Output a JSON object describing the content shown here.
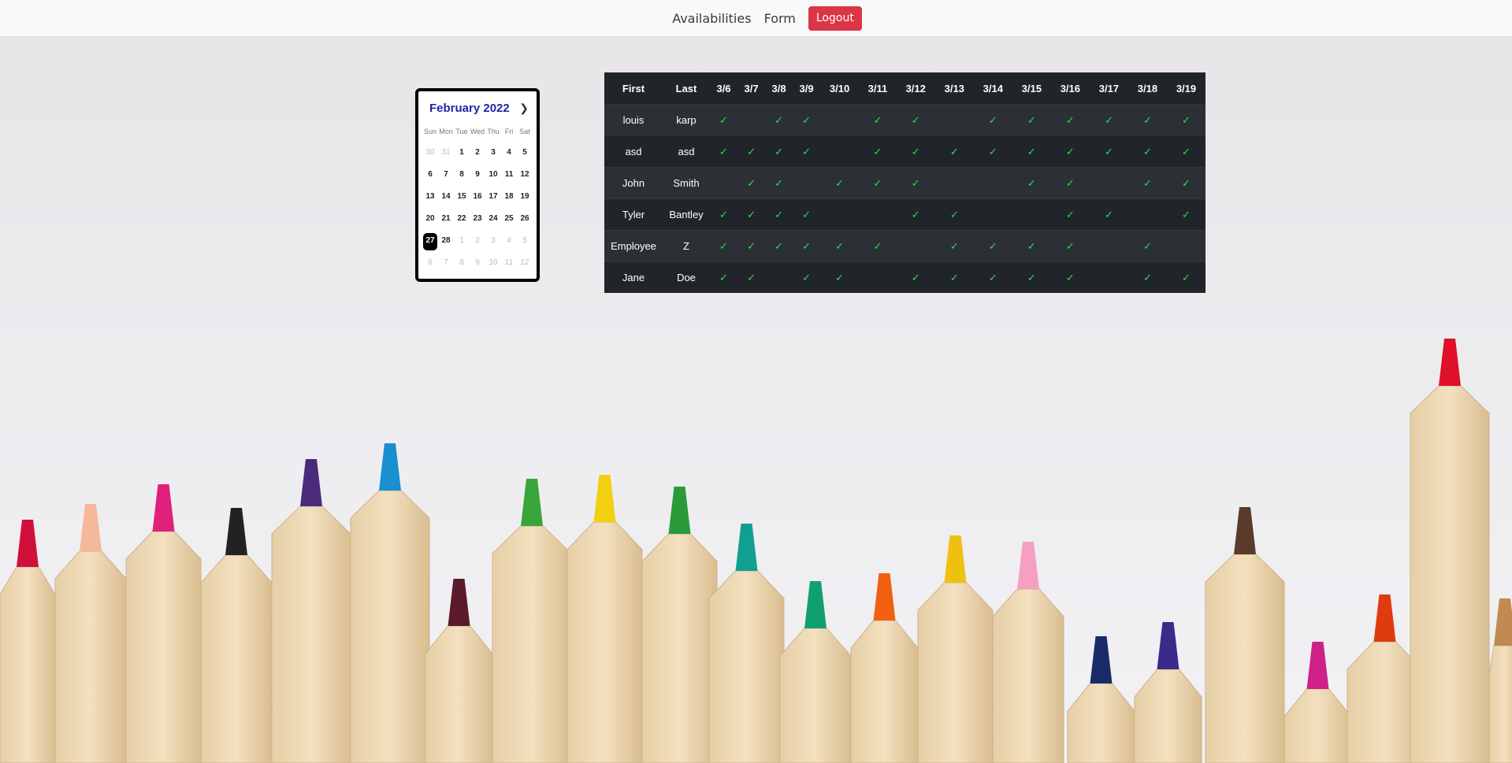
{
  "nav": {
    "links": [
      "Availabilities",
      "Form"
    ],
    "logout_label": "Logout"
  },
  "calendar": {
    "title": "February 2022",
    "weekdays": [
      "Sun",
      "Mon",
      "Tue",
      "Wed",
      "Thu",
      "Fri",
      "Sat"
    ],
    "weeks": [
      [
        {
          "d": "30",
          "m": true
        },
        {
          "d": "31",
          "m": true
        },
        {
          "d": "1"
        },
        {
          "d": "2"
        },
        {
          "d": "3"
        },
        {
          "d": "4"
        },
        {
          "d": "5"
        }
      ],
      [
        {
          "d": "6"
        },
        {
          "d": "7"
        },
        {
          "d": "8"
        },
        {
          "d": "9"
        },
        {
          "d": "10"
        },
        {
          "d": "11"
        },
        {
          "d": "12"
        }
      ],
      [
        {
          "d": "13"
        },
        {
          "d": "14"
        },
        {
          "d": "15"
        },
        {
          "d": "16"
        },
        {
          "d": "17"
        },
        {
          "d": "18"
        },
        {
          "d": "19"
        }
      ],
      [
        {
          "d": "20"
        },
        {
          "d": "21"
        },
        {
          "d": "22"
        },
        {
          "d": "23"
        },
        {
          "d": "24"
        },
        {
          "d": "25"
        },
        {
          "d": "26"
        }
      ],
      [
        {
          "d": "27",
          "s": true
        },
        {
          "d": "28"
        },
        {
          "d": "1",
          "m": true
        },
        {
          "d": "2",
          "m": true
        },
        {
          "d": "3",
          "m": true
        },
        {
          "d": "4",
          "m": true
        },
        {
          "d": "5",
          "m": true
        }
      ],
      [
        {
          "d": "6",
          "m": true
        },
        {
          "d": "7",
          "m": true
        },
        {
          "d": "8",
          "m": true
        },
        {
          "d": "9",
          "m": true
        },
        {
          "d": "10",
          "m": true
        },
        {
          "d": "11",
          "m": true
        },
        {
          "d": "12",
          "m": true
        }
      ]
    ]
  },
  "table": {
    "headers": [
      "First",
      "Last",
      "3/6",
      "3/7",
      "3/8",
      "3/9",
      "3/10",
      "3/11",
      "3/12",
      "3/13",
      "3/14",
      "3/15",
      "3/16",
      "3/17",
      "3/18",
      "3/19"
    ],
    "check_symbol": "✓",
    "rows": [
      {
        "first": "louis",
        "last": "karp",
        "avail": [
          1,
          0,
          1,
          1,
          0,
          1,
          1,
          0,
          1,
          1,
          1,
          1,
          1,
          1
        ]
      },
      {
        "first": "asd",
        "last": "asd",
        "avail": [
          1,
          1,
          1,
          1,
          0,
          1,
          1,
          1,
          1,
          1,
          1,
          1,
          1,
          1
        ]
      },
      {
        "first": "John",
        "last": "Smith",
        "avail": [
          0,
          1,
          1,
          0,
          1,
          1,
          1,
          0,
          0,
          1,
          1,
          0,
          1,
          1
        ]
      },
      {
        "first": "Tyler",
        "last": "Bantley",
        "avail": [
          1,
          1,
          1,
          1,
          0,
          0,
          1,
          1,
          0,
          0,
          1,
          1,
          0,
          1
        ]
      },
      {
        "first": "Employee",
        "last": "Z",
        "avail": [
          1,
          1,
          1,
          1,
          1,
          1,
          0,
          1,
          1,
          1,
          1,
          0,
          1,
          0
        ]
      },
      {
        "first": "Jane",
        "last": "Doe",
        "avail": [
          1,
          1,
          0,
          1,
          1,
          0,
          1,
          1,
          1,
          1,
          1,
          0,
          1,
          1
        ]
      }
    ]
  },
  "colors": {
    "navbar_bg": "#f8f9fa",
    "logout_bg": "#dc3545",
    "table_bg": "#212529",
    "check": "#33dd44",
    "calendar_title": "#2222aa"
  }
}
